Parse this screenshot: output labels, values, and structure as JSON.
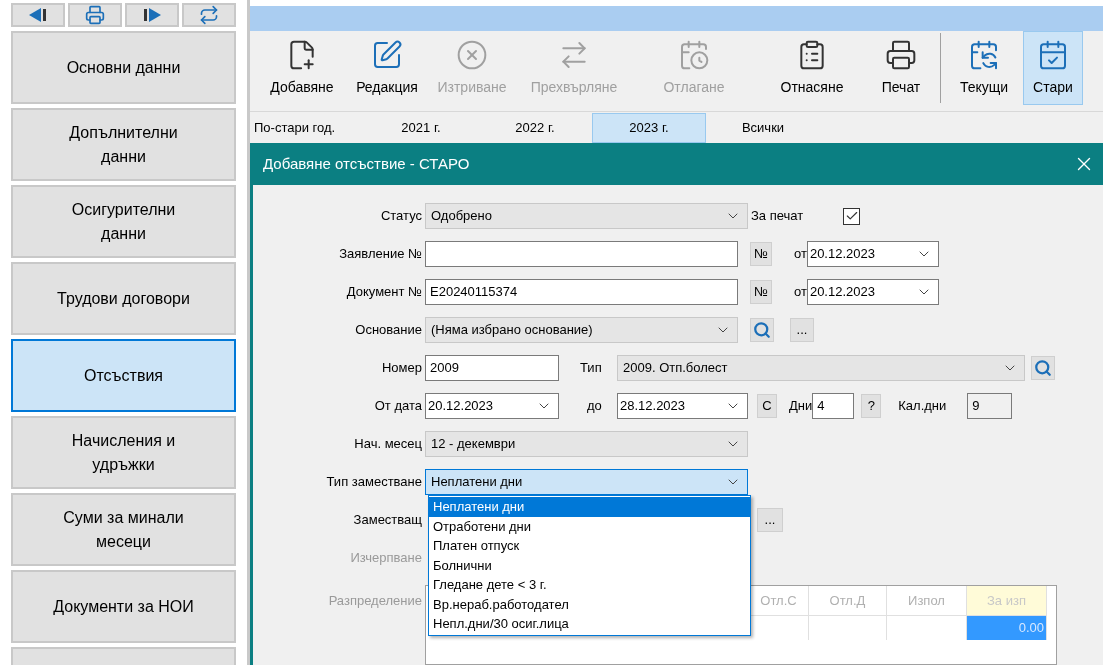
{
  "sidebar": {
    "items": [
      {
        "label": "Основни данни",
        "selected": false
      },
      {
        "label": "Допълнителни данни",
        "selected": false
      },
      {
        "label": "Осигурителни данни",
        "selected": false
      },
      {
        "label": "Трудови договори",
        "selected": false
      },
      {
        "label": "Отсъствия",
        "selected": true
      },
      {
        "label": "Начисления и удръжки",
        "selected": false
      },
      {
        "label": "Суми за минали месеци",
        "selected": false
      },
      {
        "label": "Документи за НОИ",
        "selected": false
      }
    ]
  },
  "toolbar": {
    "buttons": [
      {
        "label": "Добавяне",
        "disabled": false,
        "selected": false
      },
      {
        "label": "Редакция",
        "disabled": false,
        "selected": false
      },
      {
        "label": "Изтриване",
        "disabled": true,
        "selected": false
      },
      {
        "label": "Прехвърляне",
        "disabled": true,
        "selected": false
      },
      {
        "label": "Отлагане",
        "disabled": true,
        "selected": false
      },
      {
        "label": "Отнасяне",
        "disabled": false,
        "selected": false
      },
      {
        "label": "Печат",
        "disabled": false,
        "selected": false
      },
      {
        "label": "Текущи",
        "disabled": false,
        "selected": false
      },
      {
        "label": "Стари",
        "disabled": false,
        "selected": true
      }
    ]
  },
  "year_tabs": [
    {
      "label": "По-стари год.",
      "selected": false
    },
    {
      "label": "2021 г.",
      "selected": false
    },
    {
      "label": "2022 г.",
      "selected": false
    },
    {
      "label": "2023 г.",
      "selected": true
    },
    {
      "label": "Всички",
      "selected": false
    }
  ],
  "dialog": {
    "title": "Добавяне отсъствие - СТАРО",
    "status": {
      "label": "Статус",
      "value": "Одобрено"
    },
    "print": {
      "label": "За печат",
      "checked": true
    },
    "application": {
      "label": "Заявление №",
      "number_button": "№",
      "date_label": "от",
      "date": "20.12.2023"
    },
    "document": {
      "label": "Документ №",
      "value": "E20240115374",
      "number_button": "№",
      "date_label": "от",
      "date": "20.12.2023"
    },
    "basis": {
      "label": "Основание",
      "value": "(Няма избрано основание)",
      "more_button": "..."
    },
    "number": {
      "label": "Номер",
      "value": "2009"
    },
    "type": {
      "label": "Тип",
      "value": "2009. Отп.болест"
    },
    "period": {
      "from_label": "От дата",
      "from": "20.12.2023",
      "to_label": "до",
      "to": "28.12.2023",
      "c_button": "С",
      "days_label": "Дни",
      "days": "4",
      "help_button": "?",
      "cal_days_label": "Кал.дни",
      "cal_days": "9"
    },
    "start_month": {
      "label": "Нач. месец",
      "value": "12 - декември"
    },
    "substitution": {
      "label": "Тип заместване",
      "value": "Неплатени дни",
      "options": [
        {
          "label": "Неплатени дни",
          "selected": true
        },
        {
          "label": "Отработени дни",
          "selected": false
        },
        {
          "label": "Платен отпуск",
          "selected": false
        },
        {
          "label": "Болнични",
          "selected": false
        },
        {
          "label": "Гледане дете < 3 г.",
          "selected": false
        },
        {
          "label": "Вр.нераб.работодател",
          "selected": false
        },
        {
          "label": "Непл.дни/30 осиг.лица",
          "selected": false
        }
      ]
    },
    "substitute": {
      "label": "Заместващ",
      "more_button": "..."
    },
    "exhaustion": {
      "label": "Изчерпване",
      "disabled": true
    },
    "distribution": {
      "label": "Разпределение",
      "disabled": true,
      "columns": [
        {
          "label": "Отл.С",
          "highlight": false
        },
        {
          "label": "Отл.Д",
          "highlight": false
        },
        {
          "label": "Изпол",
          "highlight": false
        },
        {
          "label": "За изп",
          "highlight": true,
          "value": "0.00"
        }
      ]
    }
  }
}
